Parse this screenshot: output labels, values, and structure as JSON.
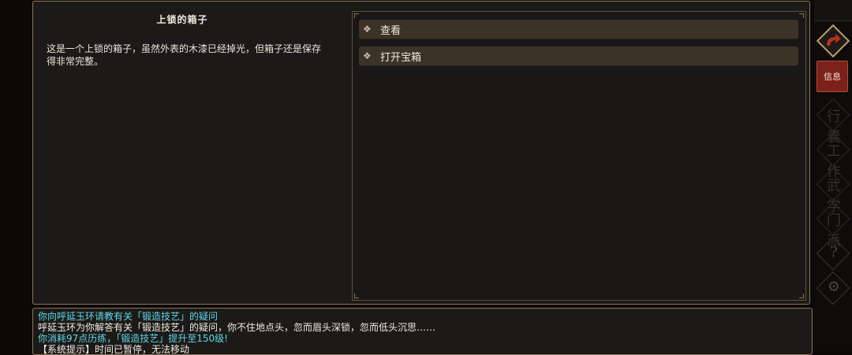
{
  "item": {
    "title": "上锁的箱子",
    "description": "这是一个上锁的箱子，虽然外表的木漆已经掉光，但箱子还是保存得非常完整。"
  },
  "options": [
    {
      "icon": "❖",
      "label": "查看"
    },
    {
      "icon": "❖",
      "label": "打开宝箱"
    }
  ],
  "log": [
    {
      "text": "你向呼延玉环请教有关「锻造技艺」的疑问",
      "color": "cyan"
    },
    {
      "text": "呼延玉环为你解答有关「锻造技艺」的疑问，你不住地点头，忽而眉头深锁，忽而低头沉思……",
      "color": "white"
    },
    {
      "text": "你消耗97点历练，「锻造技艺」提升至150级!",
      "color": "cyan"
    },
    {
      "text": "【系统提示】时间已暂停，无法移动",
      "color": "white"
    }
  ],
  "sidebar": {
    "back_icon": "return-arrow-icon",
    "info_label": "信息",
    "tabs": [
      {
        "name": "inventory",
        "ghost": "行囊"
      },
      {
        "name": "work",
        "ghost": "工作"
      },
      {
        "name": "martial",
        "ghost": "武学"
      },
      {
        "name": "sect",
        "ghost": "门派"
      },
      {
        "name": "help",
        "ghost": "?"
      },
      {
        "name": "settings",
        "ghost": "⚙"
      }
    ]
  }
}
